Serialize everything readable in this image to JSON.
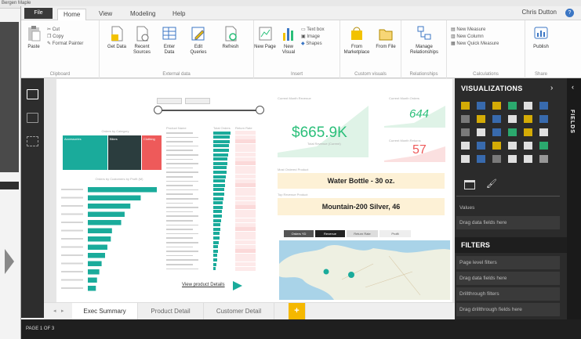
{
  "backdrop": {
    "title": "Bergen Maple"
  },
  "menubar": {
    "file_label": "File",
    "tabs": [
      "Home",
      "View",
      "Modeling",
      "Help"
    ],
    "user": "Chris Dutton"
  },
  "ribbon": {
    "clipboard": {
      "paste": "Paste",
      "cut": "Cut",
      "copy": "Copy",
      "format_painter": "Format Painter",
      "group": "Clipboard"
    },
    "external": {
      "get_data": "Get Data",
      "recent_sources": "Recent Sources",
      "enter_data": "Enter Data",
      "edit_queries": "Edit Queries",
      "refresh": "Refresh",
      "group": "External data"
    },
    "insert": {
      "new_page": "New Page",
      "new_visual": "New Visual",
      "text_box": "Text box",
      "image": "Image",
      "shapes": "Shapes",
      "group": "Insert"
    },
    "custom": {
      "from_marketplace": "From Marketplace",
      "from_file": "From File",
      "group": "Custom visuals"
    },
    "relationships": {
      "manage": "Manage Relationships",
      "group": "Relationships"
    },
    "calculations": {
      "new_measure": "New Measure",
      "new_column": "New Column",
      "new_quick_measure": "New Quick Measure",
      "group": "Calculations"
    },
    "share": {
      "publish": "Publish",
      "group": "Share"
    }
  },
  "report": {
    "slicer_chips": [
      "",
      ""
    ],
    "kpi_revenue_title": "Current Month Revenue",
    "kpi_revenue": "$665.9K",
    "kpi_revenue_sub": "Total Revenue (Current)",
    "kpi_orders_title": "Current Month Orders",
    "kpi_orders": "644",
    "kpi_returns_title": "Current Month Returns",
    "kpi_returns": "57",
    "top_product_orders_title": "Most Ordered Product",
    "top_product_orders": "Water Bottle - 30 oz.",
    "top_product_revenue_title": "Top Revenue Product",
    "top_product_revenue": "Mountain-200 Silver, 46",
    "treemap_title": "Orders by Category",
    "treemap_labels": [
      "Accessories",
      "Bikes",
      "Clothing"
    ],
    "bar_title": "Orders by Customers by Profit (M)",
    "table_headers": [
      "Product Name",
      "Total Orders",
      "Return Rate"
    ],
    "view_details": "View product Details",
    "map_tabs": [
      "Orders YD",
      "Revenue",
      "Return Rate",
      "Profit"
    ],
    "colors": {
      "teal": "#1aab9b",
      "dark": "#2b3d3e",
      "red": "#ee5a5a",
      "card": "#fdf1d6",
      "green": "#2bbf7a",
      "accent": "#f5b800"
    }
  },
  "chart_data": {
    "type": "bar",
    "categories": [
      "",
      "",
      "",
      "",
      "",
      "",
      "",
      "",
      "",
      "",
      "",
      "",
      ""
    ],
    "values": [
      60,
      46,
      37,
      32,
      29,
      21,
      20,
      17,
      15,
      12,
      10,
      8,
      7
    ]
  },
  "page_tabs": [
    "Exec Summary",
    "Product Detail",
    "Customer Detail"
  ],
  "add_tab": "+",
  "status": "PAGE 1 OF 3",
  "viz_pane": {
    "title": "VISUALIZATIONS",
    "values_label": "Values",
    "drag_values": "Drag data fields here",
    "filters_title": "FILTERS",
    "page_filters": "Page level filters",
    "drag_filters": "Drag data fields here",
    "drillthrough": "Drillthrough filters",
    "drag_drill": "Drag drillthrough fields here"
  },
  "fields_pane": {
    "label": "FIELDS"
  }
}
